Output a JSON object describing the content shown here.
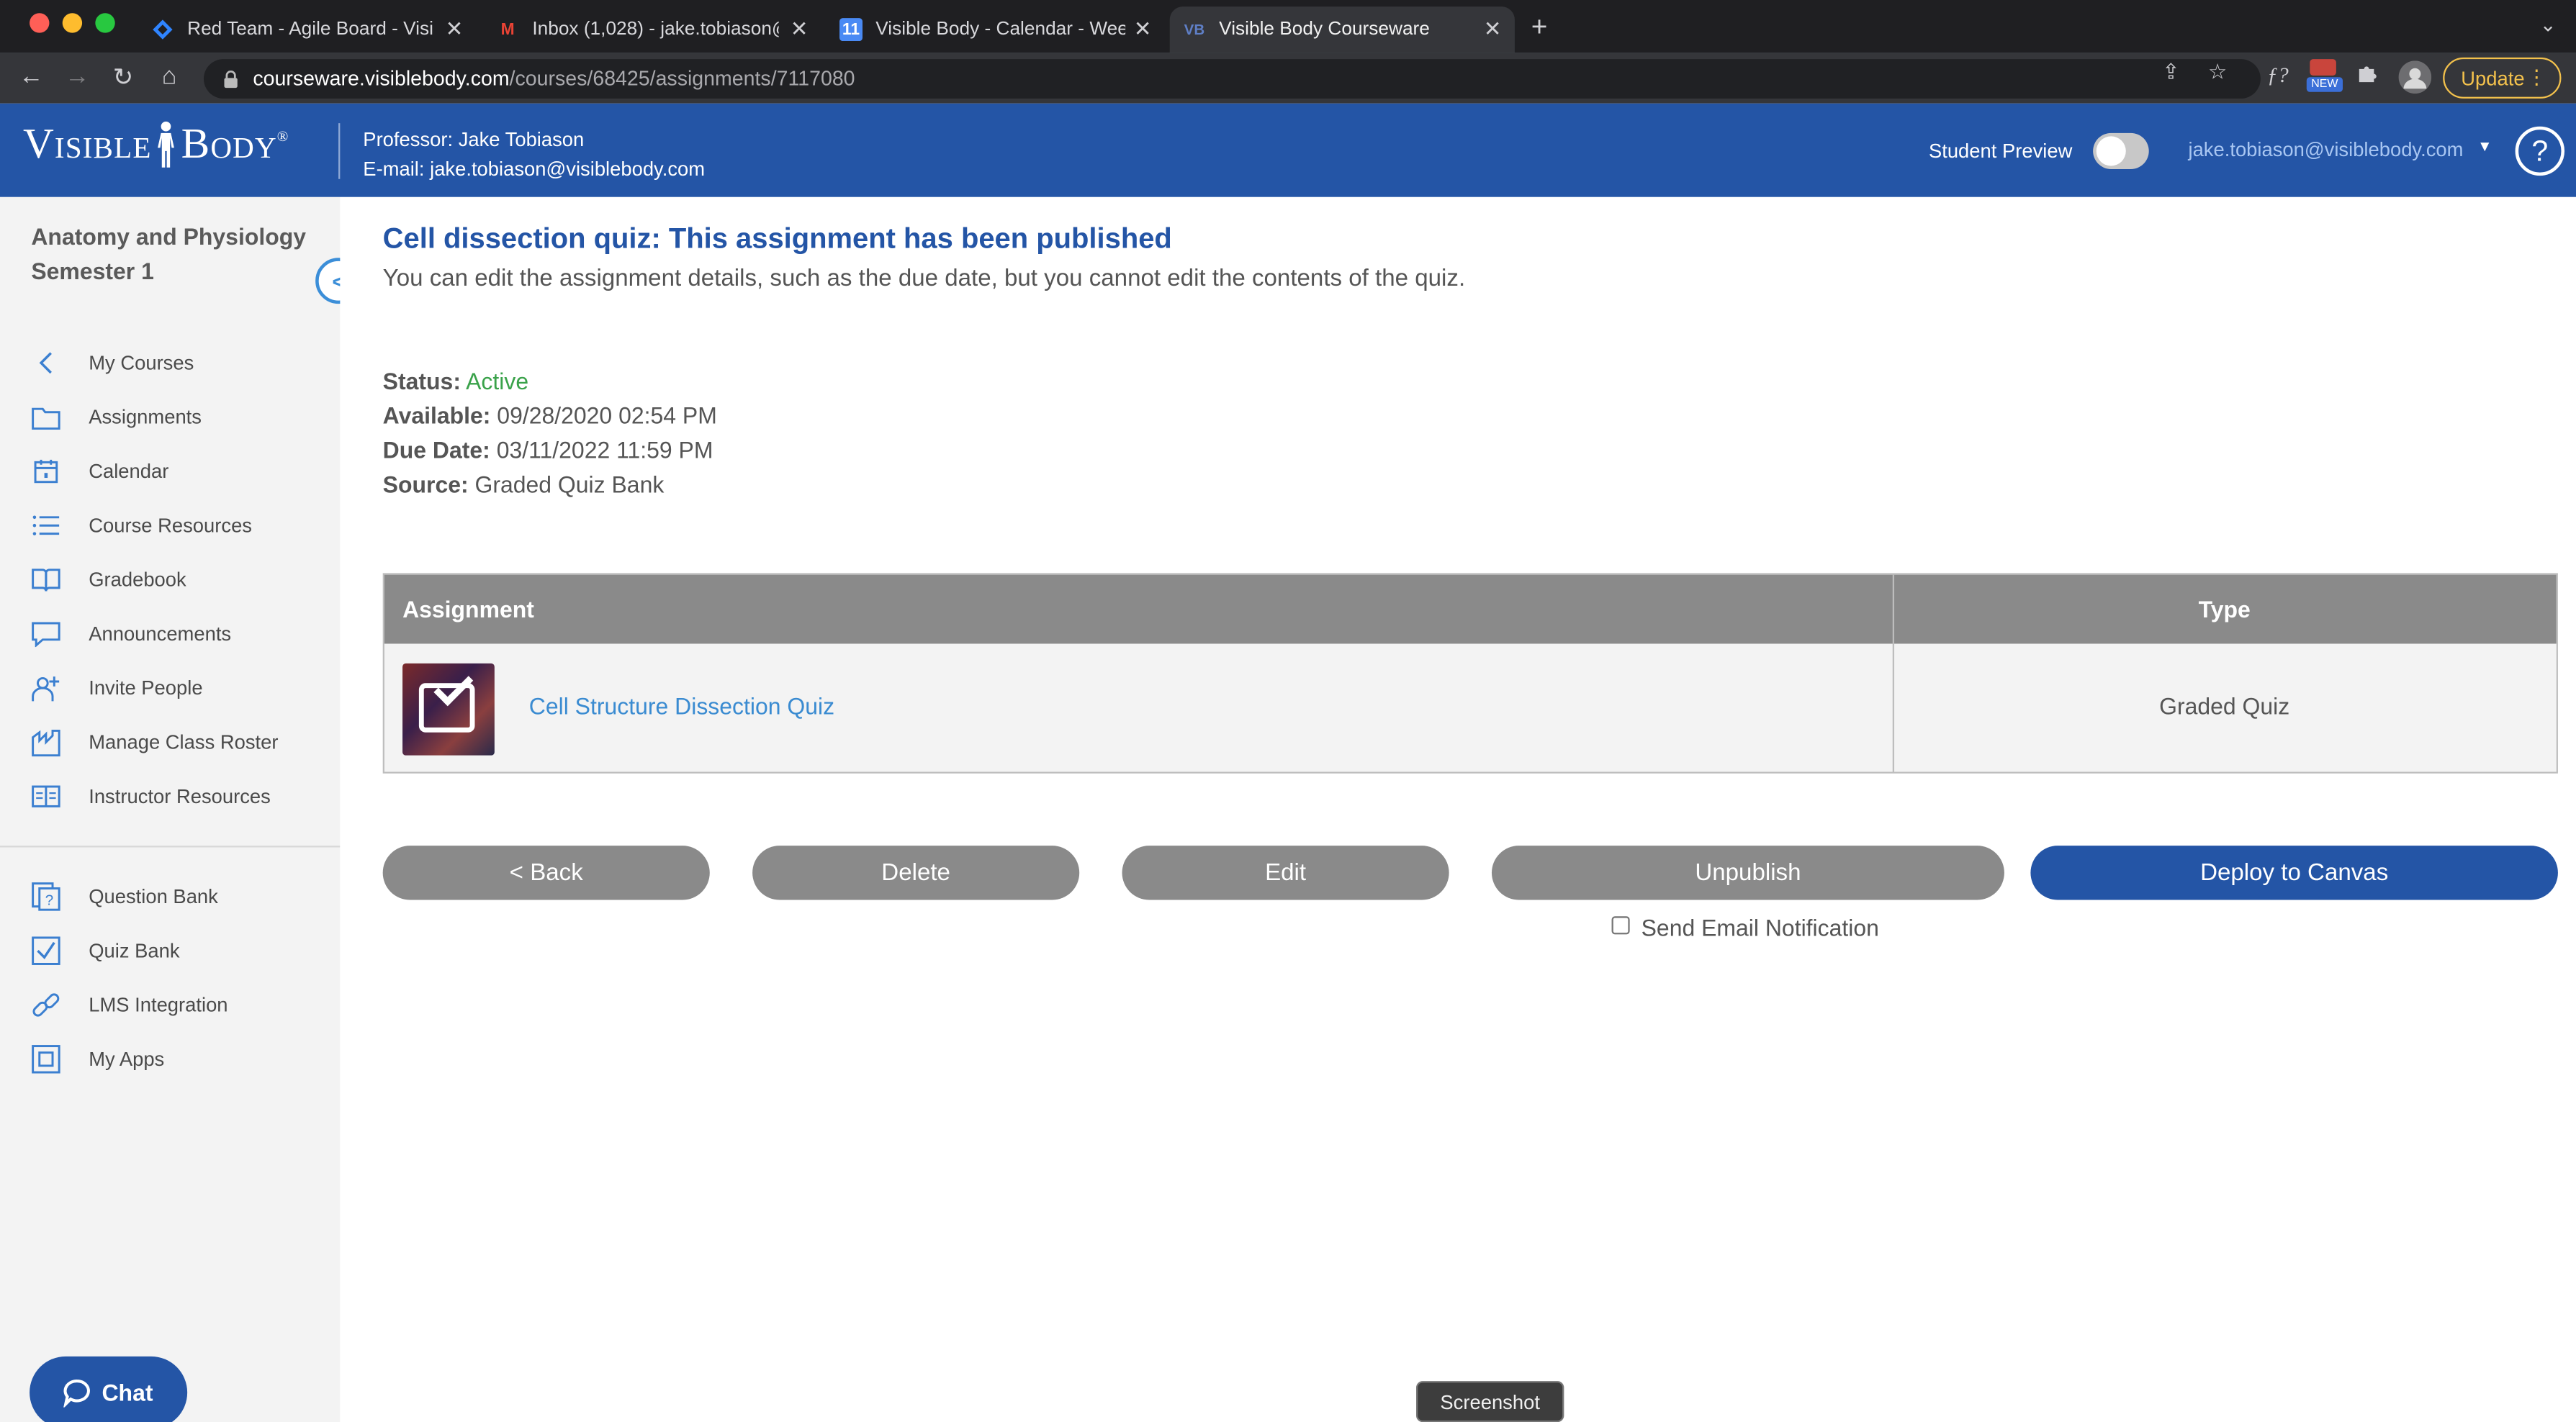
{
  "browser": {
    "tabs": [
      {
        "title": "Red Team - Agile Board - Visib",
        "icon": "jira-icon"
      },
      {
        "title": "Inbox (1,028) - jake.tobiason@",
        "icon": "gmail-icon"
      },
      {
        "title": "Visible Body - Calendar - Week",
        "icon": "calendar-icon"
      },
      {
        "title": "Visible Body Courseware",
        "icon": "visiblebody-icon",
        "active": true
      }
    ],
    "url_host": "courseware.visiblebody.com",
    "url_path": "/courses/68425/assignments/7117080",
    "update_label": "Update",
    "ext_new_badge": "NEW"
  },
  "header": {
    "logo_part1": "Visible",
    "logo_part2": "Body",
    "professor": "Professor: Jake Tobiason",
    "email": "E-mail: jake.tobiason@visiblebody.com",
    "student_preview_label": "Student Preview",
    "user_email": "jake.tobiason@visiblebody.com",
    "help_label": "?"
  },
  "sidebar": {
    "course_title": "Anatomy and Physiology Semester 1",
    "items": [
      {
        "label": "My Courses",
        "icon": "chevron-left-icon"
      },
      {
        "label": "Assignments",
        "icon": "folder-icon"
      },
      {
        "label": "Calendar",
        "icon": "calendar-icon"
      },
      {
        "label": "Course Resources",
        "icon": "list-icon"
      },
      {
        "label": "Gradebook",
        "icon": "book-icon"
      },
      {
        "label": "Announcements",
        "icon": "speech-bubble-icon"
      },
      {
        "label": "Invite People",
        "icon": "add-person-icon"
      },
      {
        "label": "Manage Class Roster",
        "icon": "roster-icon"
      },
      {
        "label": "Instructor Resources",
        "icon": "resources-icon"
      },
      {
        "label": "Question Bank",
        "icon": "question-bank-icon"
      },
      {
        "label": "Quiz Bank",
        "icon": "checkbox-icon"
      },
      {
        "label": "LMS Integration",
        "icon": "link-icon"
      },
      {
        "label": "My Apps",
        "icon": "apps-icon"
      }
    ],
    "chat_label": "Chat"
  },
  "main": {
    "title": "Cell dissection quiz: This assignment has been published",
    "subtitle": "You can edit the assignment details, such as the due date, but you cannot edit the contents of the quiz.",
    "status_label": "Status:",
    "status_value": "Active",
    "available_label": "Available:",
    "available_value": "09/28/2020 02:54 PM",
    "due_label": "Due Date:",
    "due_value": "03/11/2022 11:59 PM",
    "source_label": "Source:",
    "source_value": "Graded Quiz Bank",
    "table": {
      "col_assignment": "Assignment",
      "col_type": "Type",
      "row_name": "Cell Structure Dissection Quiz",
      "row_type": "Graded Quiz"
    },
    "buttons": {
      "back": "< Back",
      "delete": "Delete",
      "edit": "Edit",
      "unpublish": "Unpublish",
      "deploy": "Deploy to Canvas"
    },
    "send_email_label": "Send Email Notification"
  },
  "overlay": {
    "screenshot_label": "Screenshot"
  },
  "colors": {
    "brand_blue": "#2455a6",
    "status_green": "#3aa24a",
    "link_blue": "#3a8bd1",
    "button_gray": "#8a8a8a"
  }
}
